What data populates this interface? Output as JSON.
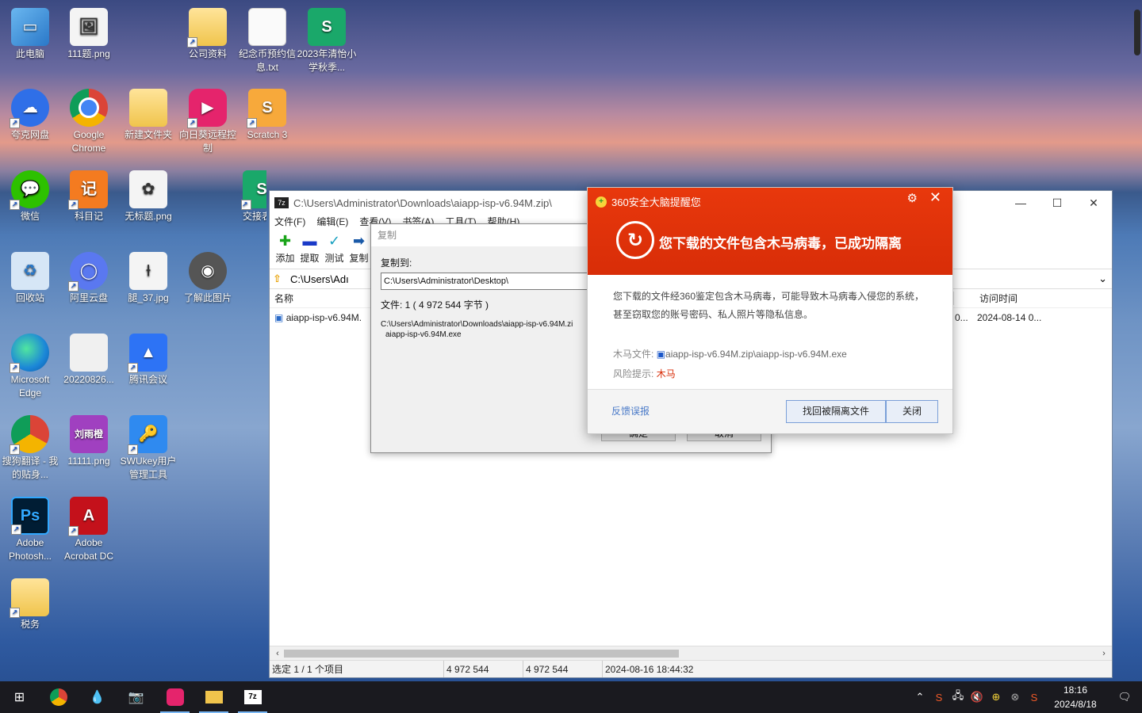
{
  "desktop_icons": [
    {
      "label": "此电脑",
      "icon": "computer-icon"
    },
    {
      "label": "111题.png",
      "icon": "image-icon"
    },
    {
      "label": "公司资料",
      "icon": "folder-icon"
    },
    {
      "label": "纪念币预约信息.txt",
      "icon": "text-file-icon"
    },
    {
      "label": "2023年清怡小学秋季...",
      "icon": "spreadsheet-icon"
    },
    {
      "label": "夸克网盘",
      "icon": "cloud-icon"
    },
    {
      "label": "Google Chrome",
      "icon": "chrome-icon"
    },
    {
      "label": "新建文件夹",
      "icon": "folder-icon"
    },
    {
      "label": "向日葵远程控制",
      "icon": "remote-control-icon"
    },
    {
      "label": "Scratch 3",
      "icon": "scratch-icon"
    },
    {
      "label": "微信",
      "icon": "wechat-icon"
    },
    {
      "label": "科目记",
      "icon": "note-icon"
    },
    {
      "label": "无标题.png",
      "icon": "image-icon"
    },
    {
      "label": "交接表",
      "icon": "spreadsheet-icon"
    },
    {
      "label": "回收站",
      "icon": "recycle-bin-icon"
    },
    {
      "label": "阿里云盘",
      "icon": "aliyun-icon"
    },
    {
      "label": "腿_37.jpg",
      "icon": "image-icon"
    },
    {
      "label": "了解此图片",
      "icon": "camera-icon"
    },
    {
      "label": "Microsoft Edge",
      "icon": "edge-icon"
    },
    {
      "label": "20220826...",
      "icon": "document-icon"
    },
    {
      "label": "腾讯会议",
      "icon": "meeting-icon"
    },
    {
      "label": "搜狗翻译 - 我的贴身...",
      "icon": "chrome-icon"
    },
    {
      "label": "11111.png",
      "icon": "image-icon"
    },
    {
      "label": "SWUkey用户管理工具",
      "icon": "key-icon"
    },
    {
      "label": "Adobe Photosh...",
      "icon": "photoshop-icon"
    },
    {
      "label": "Adobe Acrobat DC",
      "icon": "acrobat-icon"
    },
    {
      "label": "税务",
      "icon": "folder-icon"
    }
  ],
  "zip_window": {
    "title": "C:\\Users\\Administrator\\Downloads\\aiapp-isp-v6.94M.zip\\",
    "menu": [
      "文件(F)",
      "编辑(E)",
      "查看(V)",
      "书签(A)",
      "工具(T)",
      "帮助(H)"
    ],
    "toolbar": [
      "添加",
      "提取",
      "测试",
      "复制"
    ],
    "address": "C:\\Users\\Adı",
    "columns": {
      "name": "名称",
      "access": "访问时间"
    },
    "row": {
      "name": "aiapp-isp-v6.94M.",
      "modified_partial": "0...",
      "access": "2024-08-14 0..."
    },
    "status": {
      "selected": "选定 1 / 1 个项目",
      "size": "4 972 544",
      "packed": "4 972 544",
      "date": "2024-08-16 18:44:32"
    }
  },
  "copy_dialog": {
    "title": "复制",
    "copy_to_label": "复制到:",
    "destination": "C:\\Users\\Administrator\\Desktop\\",
    "file_info": "文件: 1   ( 4 972 544 字节 )",
    "source_path": "C:\\Users\\Administrator\\Downloads\\aiapp-isp-v6.94M.zi",
    "source_file": "aiapp-isp-v6.94M.exe",
    "ok": "确定",
    "cancel": "取消"
  },
  "alert_360": {
    "title": "360安全大脑提醒您",
    "headline": "您下载的文件包含木马病毒，已成功隔离",
    "body": "您下载的文件经360鉴定包含木马病毒，可能导致木马病毒入侵您的系统，甚至窃取您的账号密码、私人照片等隐私信息。",
    "file_label": "木马文件:",
    "file_value": "aiapp-isp-v6.94M.zip\\aiapp-isp-v6.94M.exe",
    "risk_label": "风险提示:",
    "risk_value": "木马",
    "feedback": "反馈误报",
    "recover": "找回被隔离文件",
    "close": "关闭",
    "accent_color": "#e0340a"
  },
  "taskbar": {
    "time": "18:16",
    "date": "2024/8/18",
    "apps": [
      "start-icon",
      "chrome-icon",
      "paint-icon",
      "camera-icon",
      "remote-control-icon",
      "explorer-icon",
      "7zip-icon"
    ]
  }
}
